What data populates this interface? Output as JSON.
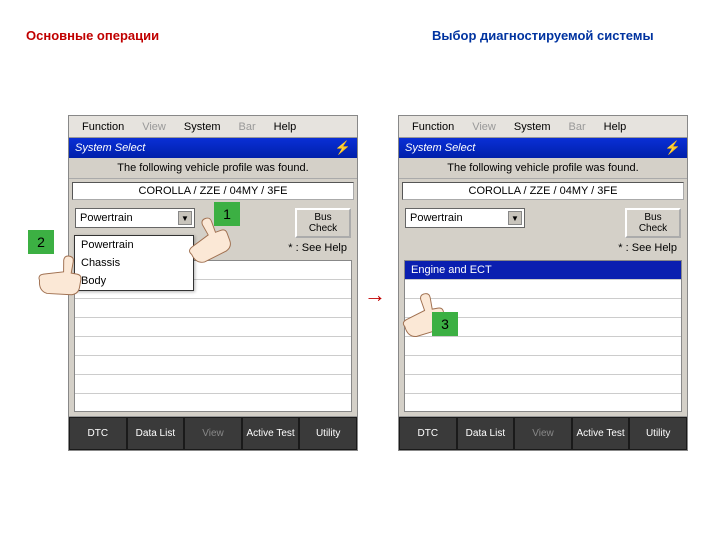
{
  "headings": {
    "left": "Основные операции",
    "right": "Выбор диагностируемой системы"
  },
  "menubar": {
    "function": "Function",
    "view": "View",
    "system": "System",
    "bar": "Bar",
    "help": "Help"
  },
  "titlebar": {
    "title": "System Select",
    "bolt": "⚡"
  },
  "info_msg": "The following vehicle profile was found.",
  "vehicle": "COROLLA / ZZE / 04MY / 3FE",
  "dropdown": {
    "selected": "Powertrain",
    "options": [
      "Powertrain",
      "Chassis",
      "Body"
    ]
  },
  "bus_check": "Bus Check",
  "see_help": "* : See Help",
  "right_list": {
    "row0": "Engine and ECT"
  },
  "bottombar": {
    "dtc": "DTC",
    "datalist": "Data List",
    "view": "View",
    "activetest": "Active Test",
    "utility": "Utility"
  },
  "markers": {
    "m1": "1",
    "m2": "2",
    "m3": "3"
  },
  "arrow": "→"
}
